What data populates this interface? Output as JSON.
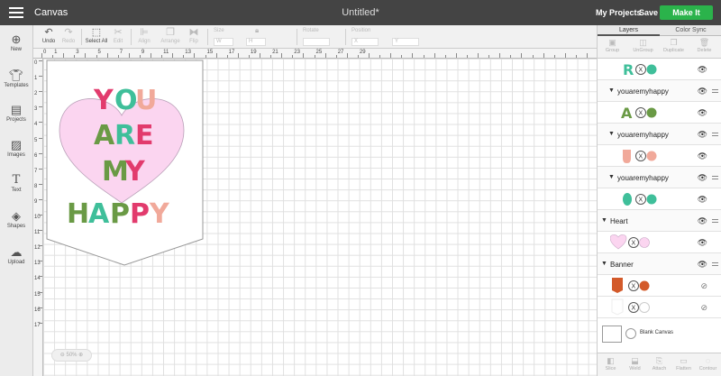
{
  "header": {
    "app_title": "Canvas",
    "doc_title": "Untitled*",
    "my_projects": "My Projects",
    "save": "Save",
    "make_it": "Make It"
  },
  "toolbar": {
    "undo": "Undo",
    "redo": "Redo",
    "select_all": "Select All",
    "edit": "Edit",
    "align": "Align",
    "arrange": "Arrange",
    "flip": "Flip",
    "size_label": "Size",
    "w_label": "W",
    "h_label": "H",
    "rotate_label": "Rotate",
    "position_label": "Position",
    "x_label": "X",
    "y_label": "Y"
  },
  "sidebar": {
    "items": [
      {
        "label": "New",
        "icon": "plus-icon"
      },
      {
        "label": "Templates",
        "icon": "shirt-icon"
      },
      {
        "label": "Projects",
        "icon": "projects-icon"
      },
      {
        "label": "Images",
        "icon": "image-icon"
      },
      {
        "label": "Text",
        "icon": "text-icon"
      },
      {
        "label": "Shapes",
        "icon": "shapes-icon"
      },
      {
        "label": "Upload",
        "icon": "upload-icon"
      }
    ]
  },
  "rulers": {
    "top": [
      "0",
      "1",
      "3",
      "5",
      "7",
      "9",
      "11",
      "13",
      "15",
      "17",
      "19",
      "21",
      "23",
      "25",
      "27",
      "29"
    ],
    "left": [
      "0",
      "1",
      "2",
      "3",
      "4",
      "5",
      "6",
      "7",
      "8",
      "9",
      "10",
      "11",
      "12",
      "13",
      "14",
      "15",
      "16",
      "17"
    ]
  },
  "canvas": {
    "zoom": "50%",
    "banner_lines": [
      "YOU",
      "ARE",
      "MY",
      "HAPPY"
    ]
  },
  "layers_panel": {
    "tabs": [
      "Layers",
      "Color Sync"
    ],
    "tools": [
      "Group",
      "UnGroup",
      "Duplicate",
      "Delete"
    ],
    "groups": [
      {
        "name": "youaremyhappy"
      },
      {
        "name": "youaremyhappy"
      },
      {
        "name": "youaremyhappy"
      },
      {
        "name": "Heart"
      },
      {
        "name": "Banner"
      }
    ],
    "blank_canvas": "Blank Canvas",
    "bottom_tools": [
      "Slice",
      "Weld",
      "Attach",
      "Flatten",
      "Contour"
    ]
  },
  "colors": {
    "pink": "#e23b6d",
    "teal": "#3fbf9a",
    "green": "#6a9a45",
    "peach": "#f1a99a",
    "heart": "#fbd5f0",
    "orange": "#d35a2a",
    "make_it": "#2bb34b"
  }
}
